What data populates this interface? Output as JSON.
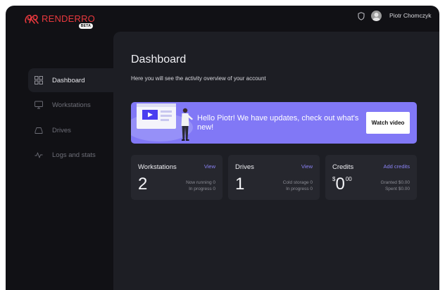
{
  "brand": {
    "name": "RENDERRO",
    "badge": "BETA",
    "color": "#e8383d"
  },
  "header": {
    "user_name": "Piotr Chomczyk",
    "icons": [
      "shield-icon",
      "avatar"
    ]
  },
  "sidebar": {
    "items": [
      {
        "label": "Dashboard",
        "icon": "grid-icon",
        "active": true
      },
      {
        "label": "Workstations",
        "icon": "monitor-icon",
        "active": false
      },
      {
        "label": "Drives",
        "icon": "drive-icon",
        "active": false
      },
      {
        "label": "Logs and stats",
        "icon": "pulse-icon",
        "active": false
      }
    ]
  },
  "main": {
    "title": "Dashboard",
    "subtitle": "Here you will see the activity overview of your account",
    "banner": {
      "text": "Hello Piotr! We have updates, check out what's new!",
      "button": "Watch video",
      "color": "#8178f6"
    },
    "cards": [
      {
        "title": "Workstations",
        "link": "View",
        "value": "2",
        "stats": [
          "Now running 0",
          "In progress 0"
        ]
      },
      {
        "title": "Drives",
        "link": "View",
        "value": "1",
        "stats": [
          "Cold storage 0",
          "In progress 0"
        ]
      },
      {
        "title": "Credits",
        "link": "Add credits",
        "currency": "$",
        "value": "0",
        "decimals": "00",
        "stats": [
          "Granted $0.00",
          "Spent $0.00"
        ]
      }
    ]
  },
  "accent_color": "#8a82f4"
}
